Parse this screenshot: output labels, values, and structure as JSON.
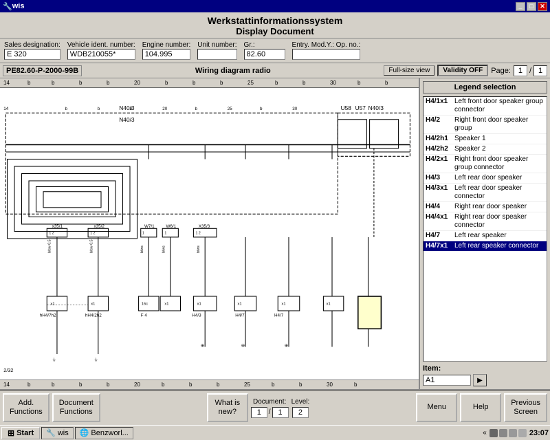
{
  "titleBar": {
    "title": "wis",
    "controls": [
      "_",
      "□",
      "✕"
    ]
  },
  "appHeader": {
    "title": "Werkstattinformationssystem",
    "subtitle": "Display Document"
  },
  "formFields": [
    {
      "label": "Sales designation:",
      "value": "E 320",
      "id": "sales-designation"
    },
    {
      "label": "Vehicle ident. number:",
      "value": "WDB210055*",
      "id": "vehicle-ident"
    },
    {
      "label": "Engine number:",
      "value": "104.995",
      "id": "engine-number"
    },
    {
      "label": "Unit number:",
      "value": "",
      "id": "unit-number"
    },
    {
      "label": "Gr.:",
      "value": "82.60",
      "id": "gr"
    },
    {
      "label": "Entry. Mod.Y.: Op. no.:",
      "value": "",
      "id": "entry-mod"
    }
  ],
  "docBar": {
    "docId": "PE82.60-P-2000-99B",
    "docTitle": "Wiring diagram radio",
    "fullSizeBtn": "Full-size view",
    "validityBtn": "Validity OFF",
    "pageLabel": "Page:",
    "pageNum": "1",
    "pageTotal": "1"
  },
  "legend": {
    "title": "Legend selection",
    "items": [
      {
        "code": "H4/1x1",
        "desc": "Left front door speaker group connector",
        "selected": false
      },
      {
        "code": "H4/2",
        "desc": "Right front door speaker group",
        "selected": false
      },
      {
        "code": "H4/2h1",
        "desc": "Speaker 1",
        "selected": false
      },
      {
        "code": "H4/2h2",
        "desc": "Speaker 2",
        "selected": false
      },
      {
        "code": "H4/2x1",
        "desc": "Right front door speaker group connector",
        "selected": false
      },
      {
        "code": "H4/3",
        "desc": "Left rear door speaker",
        "selected": false
      },
      {
        "code": "H4/3x1",
        "desc": "Left rear door speaker connector",
        "selected": false
      },
      {
        "code": "H4/4",
        "desc": "Right rear door speaker",
        "selected": false
      },
      {
        "code": "H4/4x1",
        "desc": "Right rear door speaker connector",
        "selected": false
      },
      {
        "code": "H4/7",
        "desc": "Left rear speaker",
        "selected": false
      },
      {
        "code": "H4/7x1",
        "desc": "Left rear speaker connector",
        "selected": true
      }
    ],
    "itemLabel": "Item:",
    "itemValue": "A1",
    "arrowBtn": "▶"
  },
  "toolbar": {
    "buttons": [
      {
        "label": "Add.\nFunctions",
        "id": "add-functions"
      },
      {
        "label": "Document\nFunctions",
        "id": "doc-functions"
      },
      {
        "label": "",
        "id": "spacer1"
      },
      {
        "label": "What is\nnew?",
        "id": "what-is-new"
      }
    ],
    "documentLabel": "Document:",
    "documentNum": "1",
    "documentSep": "/",
    "documentTotal": "1",
    "levelLabel": "Level:",
    "levelNum": "2",
    "menuBtn": "Menu",
    "helpBtn": "Help",
    "previousBtn": "Previous\nScreen"
  },
  "taskbar": {
    "startLabel": "Start",
    "items": [
      {
        "label": "wis",
        "icon": "wis-icon"
      },
      {
        "label": "Benzworl...",
        "icon": "ie-icon"
      }
    ],
    "arrowLeft": "«",
    "time": "23:07"
  },
  "ruler": {
    "ticks": [
      "14",
      "",
      "",
      "b",
      "",
      "",
      "b",
      "",
      "",
      "b",
      "",
      "",
      "b",
      "",
      "",
      "20",
      "",
      "",
      "",
      "",
      "25",
      "",
      "",
      "",
      "",
      "30"
    ]
  }
}
